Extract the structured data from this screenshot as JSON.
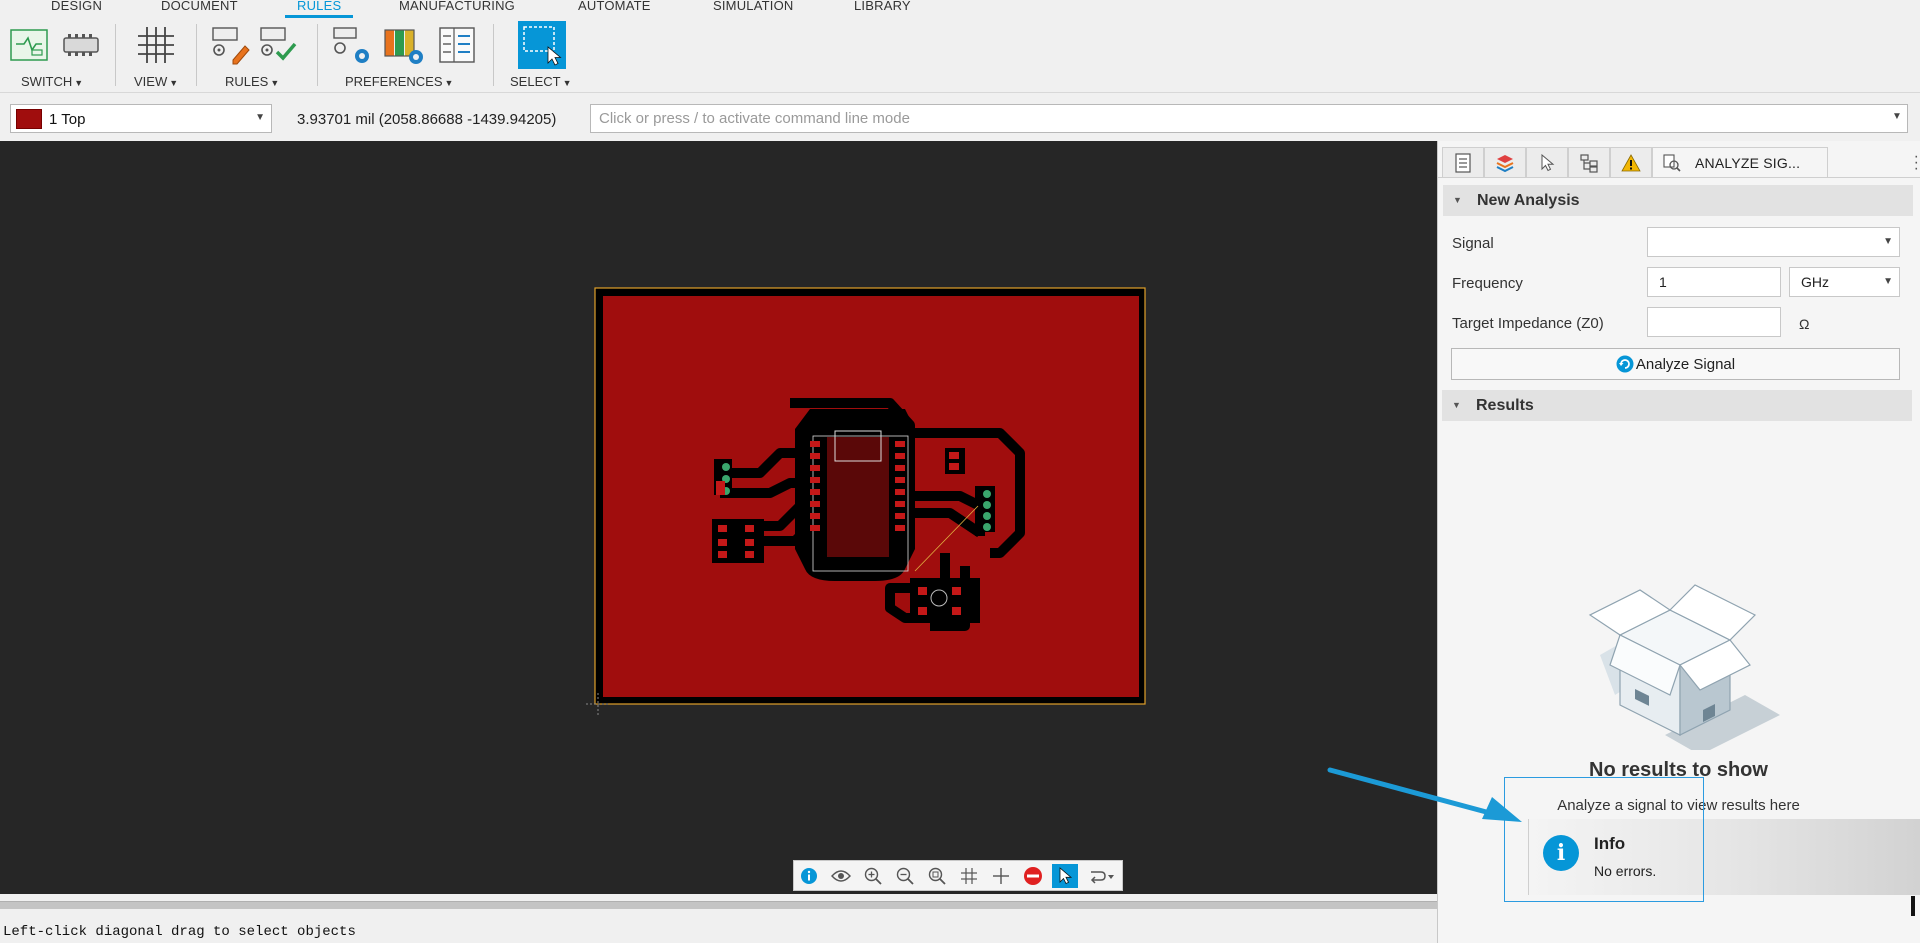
{
  "tabs": [
    "DESIGN",
    "DOCUMENT",
    "RULES",
    "MANUFACTURING",
    "AUTOMATE",
    "SIMULATION",
    "LIBRARY"
  ],
  "active_tab": "RULES",
  "ribbon": {
    "switch_label": "SWITCH",
    "view_label": "VIEW",
    "rules_label": "RULES",
    "preferences_label": "PREFERENCES",
    "select_label": "SELECT"
  },
  "layer": {
    "label": "1 Top",
    "color": "#a00d0d"
  },
  "coordinates": "3.93701 mil (2058.86688 -1439.94205)",
  "command_line": {
    "placeholder": "Click or press / to activate command line mode",
    "value": ""
  },
  "status_text": "Left-click diagonal drag to select objects",
  "panel": {
    "active_tab_label": "ANALYZE SIG...",
    "new_analysis_title": "New Analysis",
    "signal_label": "Signal",
    "signal_value": "",
    "frequency_label": "Frequency",
    "frequency_value": "1",
    "frequency_unit": "GHz",
    "impedance_label": "Target Impedance (Z0)",
    "impedance_value": "",
    "impedance_unit": "Ω",
    "analyze_button": "Analyze Signal",
    "results_title": "Results",
    "empty_title": "No results to show",
    "empty_subtitle": "Analyze a signal to view results here"
  },
  "toast": {
    "title": "Info",
    "message": "No errors."
  },
  "colors": {
    "accent": "#0696d7",
    "board": "#a00d0d",
    "canvas": "#262626"
  }
}
